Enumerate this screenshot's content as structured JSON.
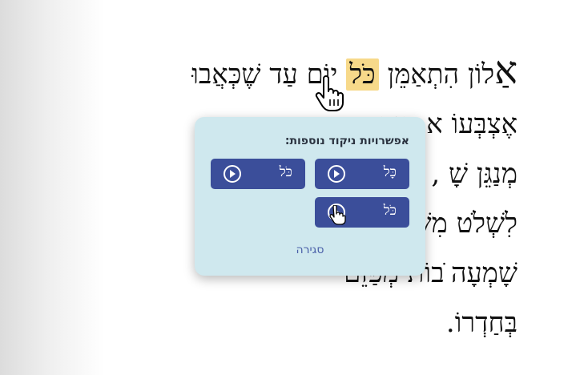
{
  "text": {
    "line1_cap": "אַ",
    "line1_pre": "לוֹן הִתְאַמֵּן ",
    "line1_hl": "כֹּל",
    "line1_post": " יוֹם עַד שֶׁכְּאֲבוּ",
    "line2": "אֶצְבְּעוֹ                                  א הָיָה",
    "line3": "מְנַגֵּן שָׁ                                    , מְנַסֶּה",
    "line4": "לִשְׁלֹט                                    מִשְׁפַּחְתּוֹ",
    "line5": "שָׁמְעָה                                   ֹבוֹת מְפַזֵּם",
    "line6": "בְּחַדְרוֹ."
  },
  "popup": {
    "title": "אפשרויות ניקוד נוספות:",
    "options": [
      {
        "label": "כָּל",
        "icon": "play-icon"
      },
      {
        "label": "כֹּל",
        "icon": "play-icon"
      },
      {
        "label": "כֹּל",
        "icon": "play-icon"
      }
    ],
    "close_label": "סגירה"
  }
}
